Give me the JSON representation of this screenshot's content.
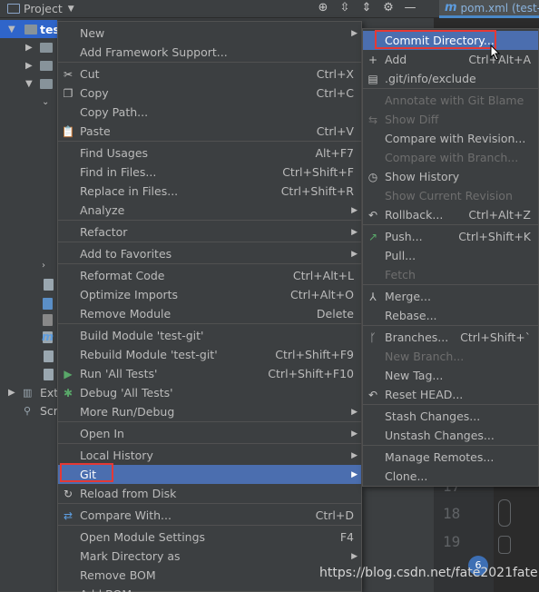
{
  "header": {
    "project_label": "Project",
    "tab_label": "pom.xml (test-"
  },
  "tree": {
    "root_label": "tes",
    "ext_label": "Ext",
    "scr_label": "Scr"
  },
  "editor": {
    "line_numbers": [
      "17",
      "18",
      "19"
    ]
  },
  "watermark": "https://blog.csdn.net/fate2021fate",
  "main_menu": {
    "items": [
      {
        "label": "New",
        "submenu": true
      },
      {
        "label": "Add Framework Support..."
      },
      {
        "label": "Cut",
        "shortcut": "Ctrl+X",
        "icon": "scissors-icon"
      },
      {
        "label": "Copy",
        "shortcut": "Ctrl+C",
        "icon": "copy-icon"
      },
      {
        "label": "Copy Path..."
      },
      {
        "label": "Paste",
        "shortcut": "Ctrl+V",
        "icon": "paste-icon"
      },
      {
        "label": "Find Usages",
        "shortcut": "Alt+F7"
      },
      {
        "label": "Find in Files...",
        "shortcut": "Ctrl+Shift+F"
      },
      {
        "label": "Replace in Files...",
        "shortcut": "Ctrl+Shift+R"
      },
      {
        "label": "Analyze",
        "submenu": true
      },
      {
        "label": "Refactor",
        "submenu": true
      },
      {
        "label": "Add to Favorites",
        "submenu": true
      },
      {
        "label": "Reformat Code",
        "shortcut": "Ctrl+Alt+L"
      },
      {
        "label": "Optimize Imports",
        "shortcut": "Ctrl+Alt+O"
      },
      {
        "label": "Remove Module",
        "shortcut": "Delete"
      },
      {
        "label": "Build Module 'test-git'"
      },
      {
        "label": "Rebuild Module 'test-git'",
        "shortcut": "Ctrl+Shift+F9"
      },
      {
        "label": "Run 'All Tests'",
        "shortcut": "Ctrl+Shift+F10",
        "icon": "run-icon"
      },
      {
        "label": "Debug 'All Tests'",
        "icon": "debug-icon"
      },
      {
        "label": "More Run/Debug",
        "submenu": true
      },
      {
        "label": "Open In",
        "submenu": true
      },
      {
        "label": "Local History",
        "submenu": true
      },
      {
        "label": "Git",
        "submenu": true,
        "selected": true
      },
      {
        "label": "Reload from Disk",
        "icon": "reload-icon"
      },
      {
        "label": "Compare With...",
        "shortcut": "Ctrl+D",
        "icon": "compare-icon"
      },
      {
        "label": "Open Module Settings",
        "shortcut": "F4"
      },
      {
        "label": "Mark Directory as",
        "submenu": true
      },
      {
        "label": "Remove BOM"
      },
      {
        "label": "Add BOM"
      }
    ]
  },
  "git_menu": {
    "items": [
      {
        "label": "Commit Directory...",
        "selected": true
      },
      {
        "label": "Add",
        "shortcut": "Ctrl+Alt+A",
        "icon": "plus-icon"
      },
      {
        "label": ".git/info/exclude",
        "icon": "git-file-icon"
      },
      {
        "label": "Annotate with Git Blame",
        "disabled": true
      },
      {
        "label": "Show Diff",
        "disabled": true,
        "icon": "diff-icon"
      },
      {
        "label": "Compare with Revision..."
      },
      {
        "label": "Compare with Branch...",
        "disabled": true
      },
      {
        "label": "Show History",
        "icon": "clock-icon"
      },
      {
        "label": "Show Current Revision",
        "disabled": true
      },
      {
        "label": "Rollback...",
        "shortcut": "Ctrl+Alt+Z",
        "icon": "rollback-icon"
      },
      {
        "label": "Push...",
        "shortcut": "Ctrl+Shift+K",
        "icon": "push-arrow-icon"
      },
      {
        "label": "Pull..."
      },
      {
        "label": "Fetch",
        "disabled": true
      },
      {
        "label": "Merge...",
        "icon": "merge-icon"
      },
      {
        "label": "Rebase..."
      },
      {
        "label": "Branches...",
        "shortcut": "Ctrl+Shift+`",
        "icon": "branch-icon"
      },
      {
        "label": "New Branch...",
        "disabled": true
      },
      {
        "label": "New Tag..."
      },
      {
        "label": "Reset HEAD...",
        "icon": "reset-icon"
      },
      {
        "label": "Stash Changes..."
      },
      {
        "label": "Unstash Changes..."
      },
      {
        "label": "Manage Remotes..."
      },
      {
        "label": "Clone..."
      }
    ]
  },
  "colors": {
    "selection": "#4b6eaf",
    "highlight_box": "#e53935",
    "menu_bg": "#3c3f41"
  }
}
